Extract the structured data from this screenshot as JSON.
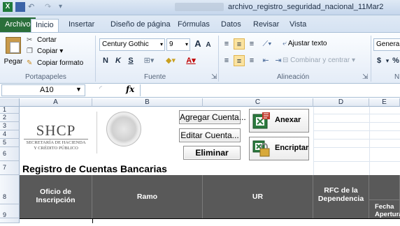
{
  "window": {
    "title": "archivo_registro_seguridad_nacional_11Mar2",
    "quick_access": {
      "undo": "↶",
      "redo": "↷",
      "more": "▾"
    }
  },
  "ribbon": {
    "tabs": [
      "Archivo",
      "Inicio",
      "Insertar",
      "Diseño de página",
      "Fórmulas",
      "Datos",
      "Revisar",
      "Vista"
    ],
    "active_tab": "Inicio",
    "clipboard": {
      "paste_label": "Pegar",
      "cut_label": "Cortar",
      "copy_label": "Copiar ▾",
      "format_painter_label": "Copiar formato",
      "group_label": "Portapapeles"
    },
    "font": {
      "font_name": "Century Gothic",
      "font_size": "9",
      "bold": "N",
      "italic": "K",
      "underline": "S",
      "grow": "A",
      "shrink": "A",
      "group_label": "Fuente"
    },
    "alignment": {
      "wrap_text": "Ajustar texto",
      "merge_center": "Combinar y centrar",
      "group_label": "Alineación"
    },
    "number": {
      "format": "General",
      "currency": "$",
      "percent": "%",
      "group_label": "N"
    }
  },
  "formula_bar": {
    "cell_ref": "A10",
    "fx": "fx",
    "value": ""
  },
  "grid": {
    "columns": [
      "A",
      "B",
      "C",
      "D",
      "E"
    ],
    "rows": [
      "1",
      "2",
      "3",
      "4",
      "5",
      "6",
      "7",
      "8",
      "9"
    ]
  },
  "logo": {
    "name": "SHCP",
    "line1": "SECRETARÍA DE HACIENDA",
    "line2": "Y CRÉDITO PÚBLICO"
  },
  "buttons": {
    "add_account": "Agregar Cuenta...",
    "edit_account": "Editar Cuenta...",
    "delete": "Eliminar",
    "attach": "Anexar",
    "encrypt": "Encriptar"
  },
  "sheet": {
    "title": "Registro de Cuentas Bancarias",
    "headers": {
      "oficio_line1": "Oficio de",
      "oficio_line2": "Inscripción",
      "ramo": "Ramo",
      "ur": "UR",
      "rfc_line1": "RFC de la",
      "rfc_line2": "Dependencia",
      "fecha_line1": "Fecha",
      "fecha_line2": "Apertura"
    }
  },
  "colors": {
    "header_dark": "#595959",
    "file_tab": "#2a6f3a",
    "ribbon_bg": "#e4ecf7"
  }
}
